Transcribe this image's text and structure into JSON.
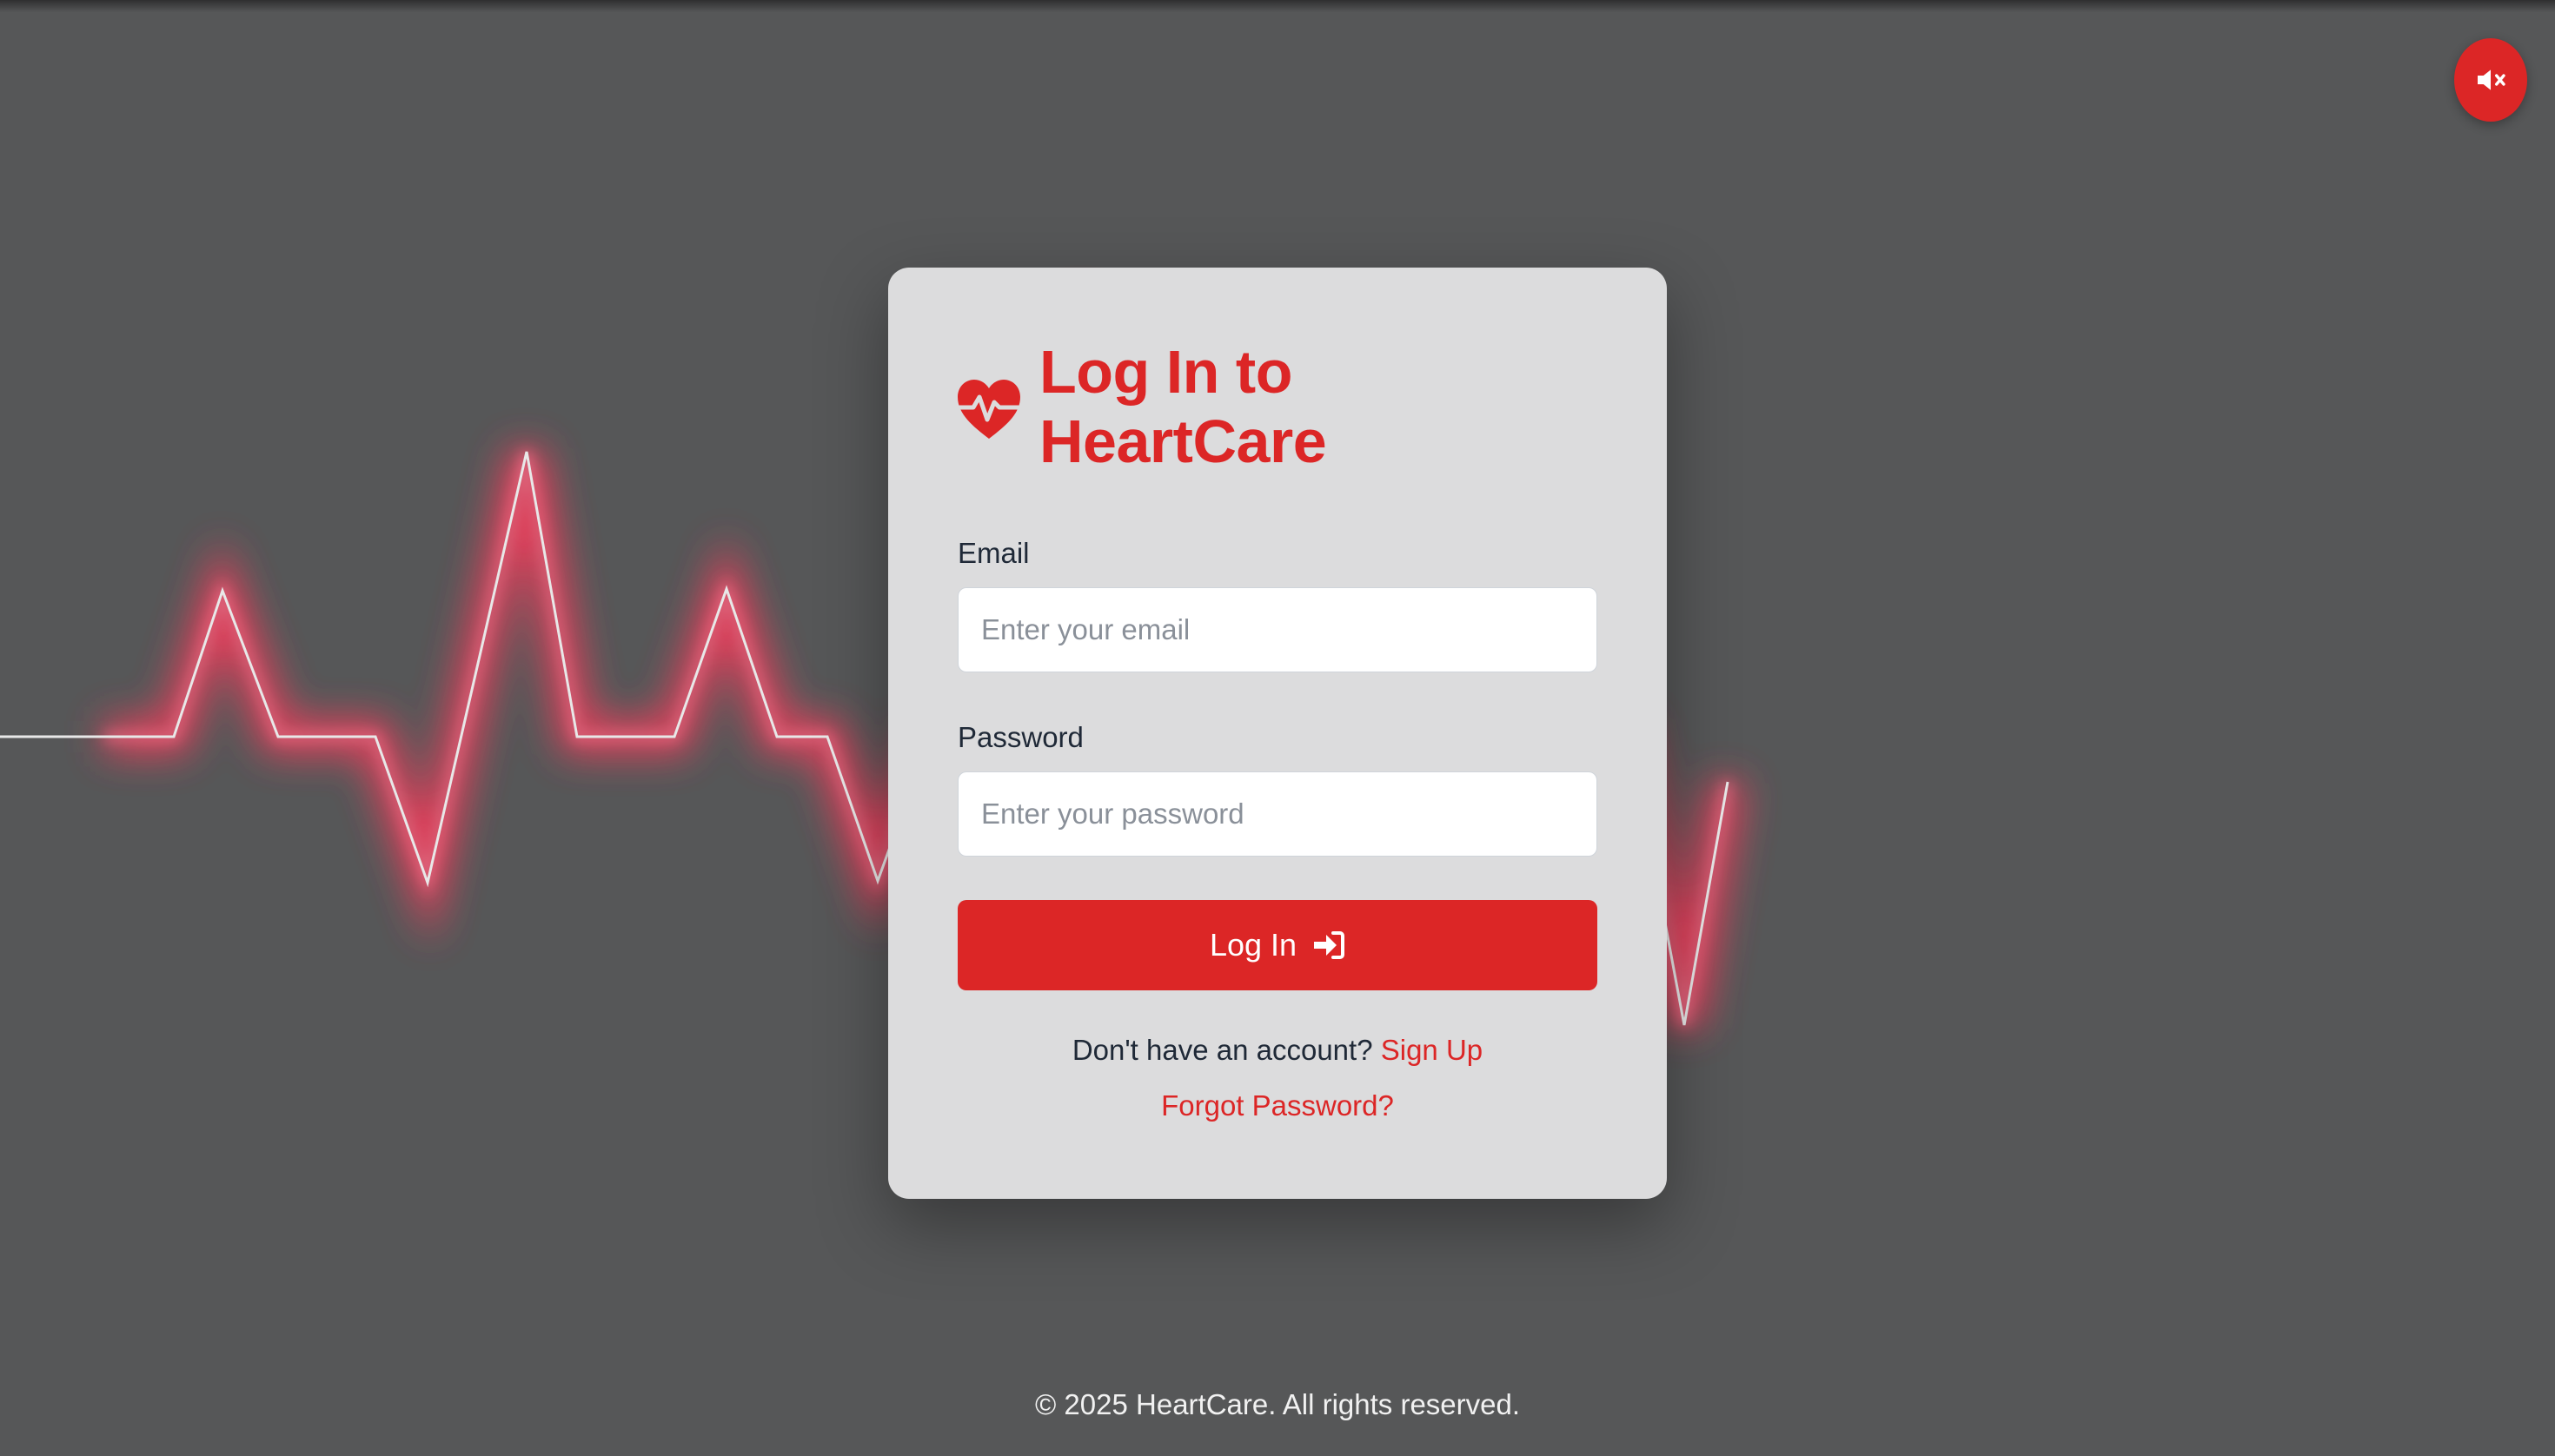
{
  "colors": {
    "background": "#565758",
    "accent": "#dc2626",
    "card": "#dcdcdd",
    "text": "#1f2937"
  },
  "mute_button": {
    "icon": "volume-mute-icon"
  },
  "card": {
    "logo_icon": "heart-pulse-icon",
    "title_line1": "Log In to",
    "title_line2": "HeartCare",
    "email": {
      "label": "Email",
      "placeholder": "Enter your email",
      "value": ""
    },
    "password": {
      "label": "Password",
      "placeholder": "Enter your password",
      "value": ""
    },
    "login_button": {
      "label": "Log In",
      "icon": "sign-in-icon"
    },
    "signup_prompt": "Don't have an account?",
    "signup_link": "Sign Up",
    "forgot_link": "Forgot Password?"
  },
  "footer": {
    "text": "© 2025 HeartCare. All rights reserved."
  }
}
